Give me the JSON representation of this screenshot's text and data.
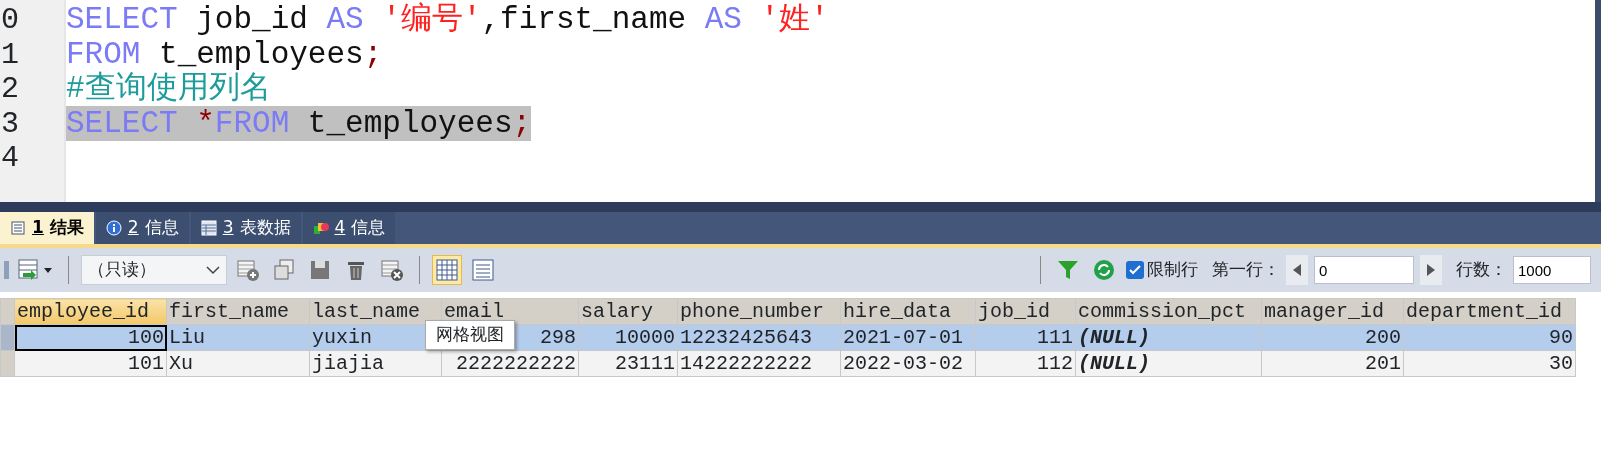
{
  "editor": {
    "lines": [
      {
        "number": "0",
        "highlighted": false,
        "tokens": [
          {
            "kind": "keyword",
            "text": "SELECT"
          },
          {
            "kind": "plain",
            "text": " job_id "
          },
          {
            "kind": "keyword",
            "text": "AS "
          },
          {
            "kind": "string",
            "text": "'编号'"
          },
          {
            "kind": "plain",
            "text": ",first_name "
          },
          {
            "kind": "keyword",
            "text": "AS "
          },
          {
            "kind": "string",
            "text": "'姓'"
          }
        ]
      },
      {
        "number": "1",
        "highlighted": false,
        "tokens": [
          {
            "kind": "keyword",
            "text": "FROM"
          },
          {
            "kind": "plain",
            "text": " t_employees"
          },
          {
            "kind": "operator",
            "text": ";"
          }
        ]
      },
      {
        "number": "2",
        "highlighted": false,
        "tokens": [
          {
            "kind": "comment",
            "text": "#查询使用列名"
          }
        ]
      },
      {
        "number": "3",
        "highlighted": true,
        "tokens": [
          {
            "kind": "keyword",
            "text": "SELECT "
          },
          {
            "kind": "operator",
            "text": "*"
          },
          {
            "kind": "keyword",
            "text": "FROM"
          },
          {
            "kind": "plain",
            "text": " t_employees"
          },
          {
            "kind": "operator",
            "text": ";"
          }
        ]
      },
      {
        "number": "4",
        "highlighted": false
      }
    ]
  },
  "tabs": [
    {
      "key": "1",
      "label": "结果",
      "kind": "results",
      "selected": true
    },
    {
      "key": "2",
      "label": "信息",
      "kind": "info",
      "selected": false
    },
    {
      "key": "3",
      "label": "表数据",
      "kind": "table",
      "selected": false
    },
    {
      "key": "4",
      "label": "信息",
      "kind": "shapes",
      "selected": false
    }
  ],
  "toolbar": {
    "mode_select": {
      "value": "（只读）"
    },
    "view_buttons": [
      {
        "kind": "grid",
        "selected": true
      },
      {
        "kind": "form",
        "selected": false
      }
    ],
    "limit_rows": {
      "label": "限制行",
      "checked": true
    },
    "first_row": {
      "label": "第一行：",
      "value": "0"
    },
    "row_count": {
      "label": "行数：",
      "value": "1000"
    }
  },
  "grid": {
    "columns": [
      {
        "name": "employee_id",
        "kind": "number",
        "selected": true
      },
      {
        "name": "first_name",
        "kind": "text",
        "selected": false
      },
      {
        "name": "last_name",
        "kind": "text",
        "selected": false
      },
      {
        "name": "email",
        "kind": "number",
        "selected": false
      },
      {
        "name": "salary",
        "kind": "number",
        "selected": false
      },
      {
        "name": "phone_number",
        "kind": "text",
        "selected": false
      },
      {
        "name": "hire_data",
        "kind": "text",
        "selected": false
      },
      {
        "name": "job_id",
        "kind": "number",
        "selected": false
      },
      {
        "name": "commission_pct",
        "kind": "null",
        "selected": false
      },
      {
        "name": "manager_id",
        "kind": "number",
        "selected": false
      },
      {
        "name": "department_id",
        "kind": "number",
        "selected": false
      }
    ],
    "rows": [
      {
        "selected": true,
        "focused": true,
        "cells": [
          "100",
          "Liu",
          "yuxin",
          "298",
          "10000",
          "12232425643",
          "2021-07-01",
          "111",
          "(NULL)",
          "200",
          "90"
        ]
      },
      {
        "selected": false,
        "focused": false,
        "cells": [
          "101",
          "Xu",
          "jiajia",
          "2222222222",
          "23111",
          "14222222222",
          "2022-03-02",
          "112",
          "(NULL)",
          "201",
          "30"
        ]
      }
    ],
    "tooltip": "网格视图"
  }
}
